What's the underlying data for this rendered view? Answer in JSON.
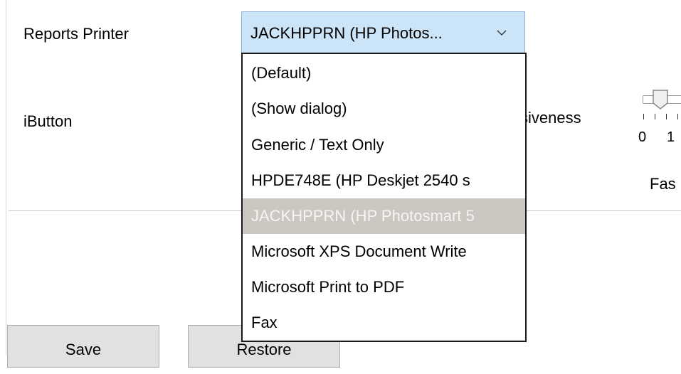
{
  "labels": {
    "reports_printer": "Reports Printer",
    "ibutton": "iButton",
    "responsiveness_partial": "siveness",
    "fast_partial": "Fas"
  },
  "combo": {
    "value": "JACKHPPRN (HP Photos...",
    "chevron_icon": "chevron-down-icon"
  },
  "dropdown": {
    "options": [
      "(Default)",
      "(Show dialog)",
      "Generic / Text Only",
      "HPDE748E (HP Deskjet 2540 s",
      "JACKHPPRN (HP Photosmart 5",
      "Microsoft XPS Document Write",
      "Microsoft Print to PDF",
      "Fax"
    ],
    "selected_index": 4
  },
  "slider": {
    "tick_labels": [
      "0",
      "1"
    ]
  },
  "buttons": {
    "save": "Save",
    "restore": "Restore"
  },
  "colors": {
    "combo_bg": "#cce4f7",
    "selected_bg": "#cbc8c2",
    "button_bg": "#e1e1e1"
  }
}
